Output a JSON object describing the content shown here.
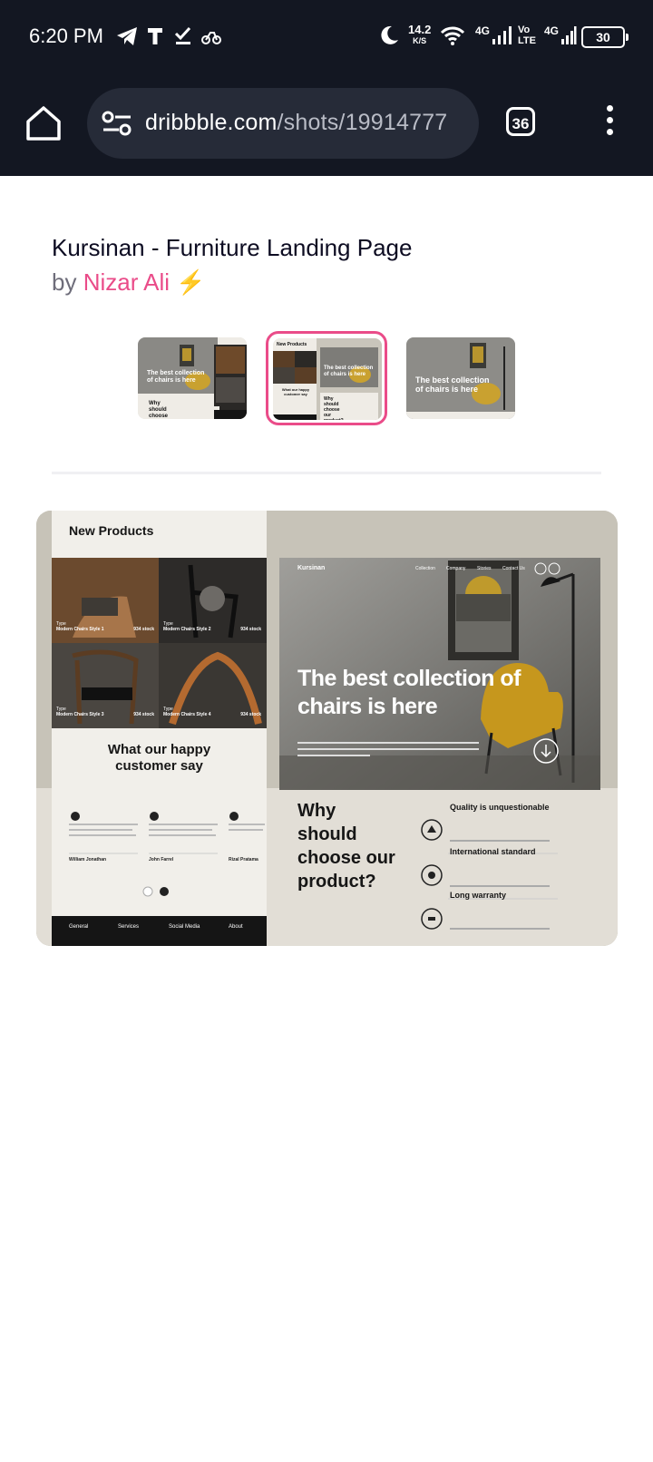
{
  "status": {
    "time": "6:20 PM",
    "net_speed": "14.2",
    "net_unit": "K/S",
    "sim1": "4G",
    "volte": "Vo LTE",
    "sim2": "4G",
    "battery": "30"
  },
  "browser": {
    "url_domain": "dribbble.com",
    "url_path": "/shots/19914777",
    "tab_count": "36"
  },
  "shot": {
    "title": "Kursinan - Furniture Landing Page",
    "by_label": "by",
    "author": "Nizar Ali",
    "author_badge": "⚡"
  },
  "thumbs": {
    "t1_heading": "The best collection of chairs is here",
    "t1_why": "Why should choose our",
    "t2_title": "New Products",
    "t2_heading": "The best collection of chairs is here",
    "t2_happy": "What our happy customer say",
    "t2_why": "Why should choose our product?",
    "t3_heading": "The best collection of chairs is here"
  },
  "preview": {
    "new_products": "New Products",
    "products": [
      {
        "type": "Type",
        "name": "Modern Chairs Style 1",
        "stock": "934 stock"
      },
      {
        "type": "Type",
        "name": "Modern Chairs Style 2",
        "stock": "934 stock"
      },
      {
        "type": "Type",
        "name": "Modern Chairs Style 3",
        "stock": "934 stock"
      },
      {
        "type": "Type",
        "name": "Modern Chairs Style 4",
        "stock": "934 stock"
      }
    ],
    "testimonial_heading_1": "What our happy",
    "testimonial_heading_2": "customer say",
    "reviewers": [
      "William Jonathan",
      "John Farrel",
      "Rizal Pratama"
    ],
    "footer": [
      "General",
      "Services",
      "Social Media",
      "About"
    ],
    "brand": "Kursinan",
    "nav": [
      "Collection",
      "Company",
      "Stories",
      "Contact Us"
    ],
    "hero_1": "The best collection of",
    "hero_2": "chairs is here",
    "why": [
      "Why",
      "should",
      "choose our",
      "product?"
    ],
    "features": [
      "Quality is unquestionable",
      "International standard",
      "Long warranty"
    ]
  }
}
